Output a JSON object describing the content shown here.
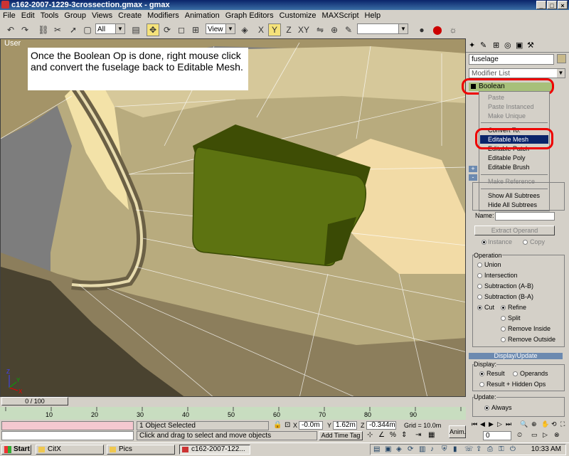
{
  "window": {
    "title": "c162-2007-1229-3crossection.gmax - gmax"
  },
  "menu": [
    "File",
    "Edit",
    "Tools",
    "Group",
    "Views",
    "Create",
    "Modifiers",
    "Animation",
    "Graph Editors",
    "Customize",
    "MAXScript",
    "Help"
  ],
  "toolbar": {
    "selection_filter": "All",
    "ref_coord": "View",
    "named_selection": ""
  },
  "viewport": {
    "label": "User",
    "callout": "Once the Boolean Op is done, right mouse click and convert the fuselage back to Editable Mesh."
  },
  "command_panel": {
    "object_name": "fuselage",
    "modifier_list": "Modifier List",
    "stack_item": "Boolean",
    "context_menu": {
      "items_disabled": [
        "Paste",
        "Paste Instanced",
        "Make Unique"
      ],
      "convert_to": "Convert To:",
      "items": [
        "Editable Mesh",
        "Editable Patch",
        "Editable Poly",
        "Editable Brush"
      ],
      "highlighted": "Editable Mesh",
      "make_reference": "Make Reference",
      "show_all": "Show All Subtrees",
      "hide_all": "Hide All Subtrees"
    },
    "pick_rollout": "+",
    "params_rollout": "-",
    "name_label": "Name:",
    "extract_operand": "Extract Operand",
    "instance": "Instance",
    "copy": "Copy",
    "operation": {
      "label": "Operation",
      "union": "Union",
      "intersection": "Intersection",
      "subtraction_ab": "Subtraction (A-B)",
      "subtraction_ba": "Subtraction (B-A)",
      "cut": "Cut",
      "refine": "Refine",
      "split": "Split",
      "remove_inside": "Remove Inside",
      "remove_outside": "Remove Outside"
    },
    "display_update": {
      "rollout": "Display/Update",
      "display_label": "Display:",
      "result": "Result",
      "operands": "Operands",
      "result_hidden": "Result + Hidden Ops",
      "update_label": "Update:",
      "always": "Always"
    }
  },
  "timeline": {
    "frame": "0 / 100",
    "ticks": [
      "10",
      "20",
      "30",
      "40",
      "50",
      "60",
      "70",
      "80",
      "90"
    ]
  },
  "status": {
    "selected": "1 Object Selected",
    "prompt": "Click and drag to select and move objects",
    "x_label": "X",
    "x_value": "-0.0m",
    "y_label": "Y",
    "y_value": "1.62m",
    "z_label": "Z",
    "z_value": "-0.344m",
    "grid": "Grid = 10.0m",
    "add_time_tag": "Add Time Tag",
    "anim": "Anim.",
    "frame_field": "0"
  },
  "taskbar": {
    "start": "Start",
    "tasks": [
      "CitX",
      "Pics",
      "c162-2007-122..."
    ],
    "clock": "10:33 AM"
  },
  "colors": {
    "highlight": "#0a246a",
    "callout_circle": "#e00000",
    "boolean_operand": "#5a6e10",
    "fuselage": "#c8b98a"
  }
}
